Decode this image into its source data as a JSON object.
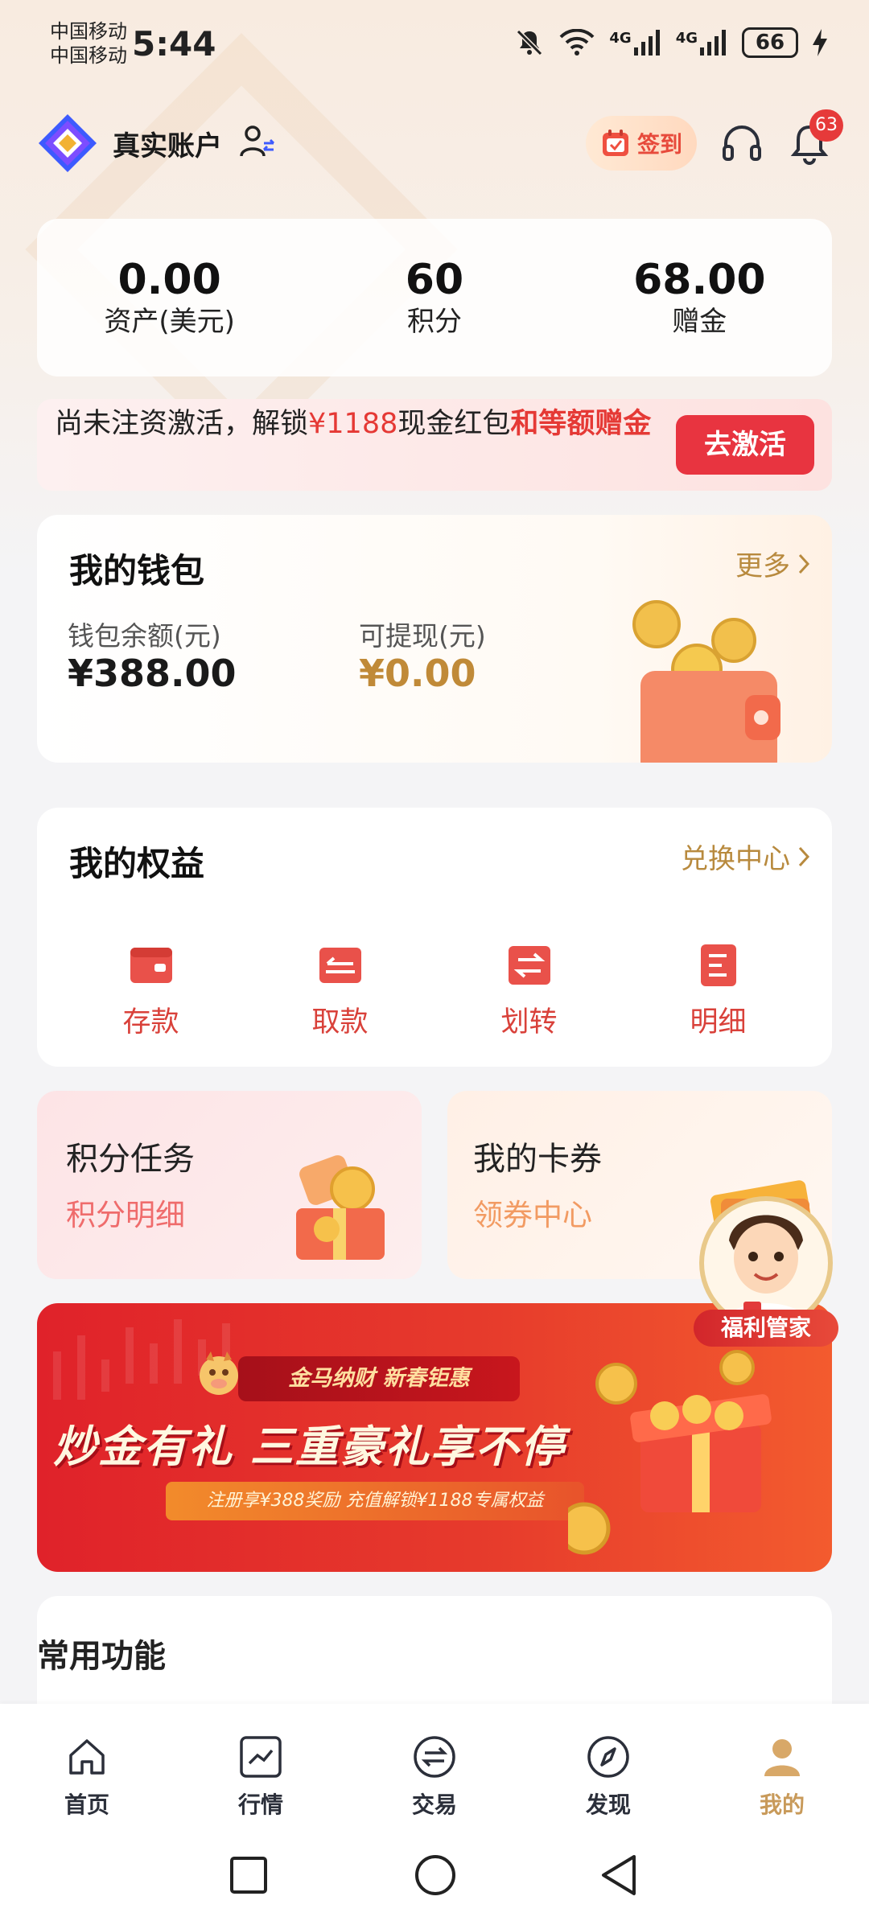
{
  "status_bar": {
    "carrier_1": "中国移动",
    "carrier_2": "中国移动",
    "time": "5:44",
    "network_1": "4G",
    "network_2": "4G",
    "battery": "66"
  },
  "header": {
    "account_name": "真实账户",
    "checkin_label": "签到",
    "notification_count": "63"
  },
  "assets": [
    {
      "value": "0.00",
      "label": "资产(美元)"
    },
    {
      "value": "60",
      "label": "积分"
    },
    {
      "value": "68.00",
      "label": "赠金"
    }
  ],
  "activate": {
    "text_1": "尚未注资激活，解锁",
    "amount": "¥1188",
    "text_2": "现金红包",
    "text_3": "和等额赠金",
    "button": "去激活"
  },
  "wallet": {
    "title": "我的钱包",
    "more": "更多",
    "balance_label": "钱包余额(元)",
    "balance_value": "¥388.00",
    "withdraw_label": "可提现(元)",
    "withdraw_value": "¥0.00"
  },
  "rights": {
    "title": "我的权益",
    "link": "兑换中心",
    "items": [
      {
        "label": "存款",
        "icon": "deposit-icon"
      },
      {
        "label": "取款",
        "icon": "withdraw-icon"
      },
      {
        "label": "划转",
        "icon": "transfer-icon"
      },
      {
        "label": "明细",
        "icon": "details-icon"
      }
    ]
  },
  "tasks": [
    {
      "title": "积分任务",
      "subtitle": "积分明细"
    },
    {
      "title": "我的卡券",
      "subtitle": "领券中心"
    }
  ],
  "assistant": {
    "label": "福利管家"
  },
  "promo": {
    "ribbon": "金马纳财 新春钜惠",
    "headline": "炒金有礼 三重豪礼享不停",
    "subline": "注册享¥388奖励 充值解锁¥1188专属权益"
  },
  "common": {
    "title": "常用功能"
  },
  "tabbar": [
    {
      "label": "首页",
      "icon": "home-icon"
    },
    {
      "label": "行情",
      "icon": "market-icon"
    },
    {
      "label": "交易",
      "icon": "trade-icon"
    },
    {
      "label": "发现",
      "icon": "discover-icon"
    },
    {
      "label": "我的",
      "icon": "profile-icon"
    }
  ],
  "colors": {
    "accent_red": "#e83440",
    "gold": "#c89a5a",
    "wallet_gold": "#c08a38"
  }
}
